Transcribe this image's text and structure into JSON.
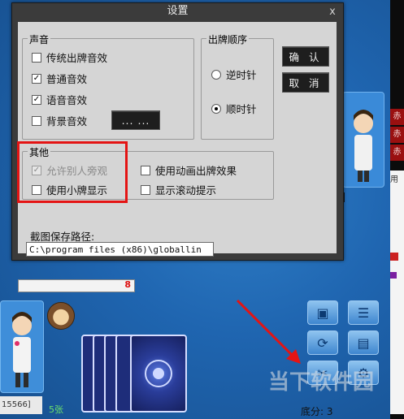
{
  "dialog": {
    "title": "设置",
    "close_glyph": "x",
    "sound_group": {
      "legend": "声音",
      "items": [
        {
          "label": "传统出牌音效",
          "checked": false
        },
        {
          "label": "普通音效",
          "checked": true
        },
        {
          "label": "语音音效",
          "checked": true
        },
        {
          "label": "背景音效",
          "checked": false
        }
      ],
      "browse_button": "... ..."
    },
    "order_group": {
      "legend": "出牌顺序",
      "options": [
        {
          "label": "逆时针",
          "selected": false
        },
        {
          "label": "顺时针",
          "selected": true
        }
      ]
    },
    "confirm_button": "确 认",
    "cancel_button": "取 消",
    "other_group": {
      "legend": "其他",
      "items": [
        {
          "label": "允许别人旁观",
          "checked": true,
          "disabled": true
        },
        {
          "label": "使用小牌显示",
          "checked": false,
          "disabled": false
        },
        {
          "label": "使用动画出牌效果",
          "checked": false,
          "disabled": false
        },
        {
          "label": "显示滚动提示",
          "checked": false,
          "disabled": false
        }
      ]
    },
    "path_label": "截图保存路径:",
    "path_value": "C:\\program files (x86)\\globallin"
  },
  "game": {
    "player_id": "15566]",
    "card_count": "5张",
    "score_text": "底分: 3",
    "bracket": "]",
    "side_labels": [
      "赤",
      "赤",
      "赤"
    ],
    "side_menu": "用",
    "watermark": "当下软件园",
    "hand_number": "8"
  },
  "colors": {
    "annotation": "#e41414",
    "dialog_frame": "#3b3b3b",
    "dialog_client": "#d5d5d5",
    "table_bg": "#1f65b0"
  }
}
